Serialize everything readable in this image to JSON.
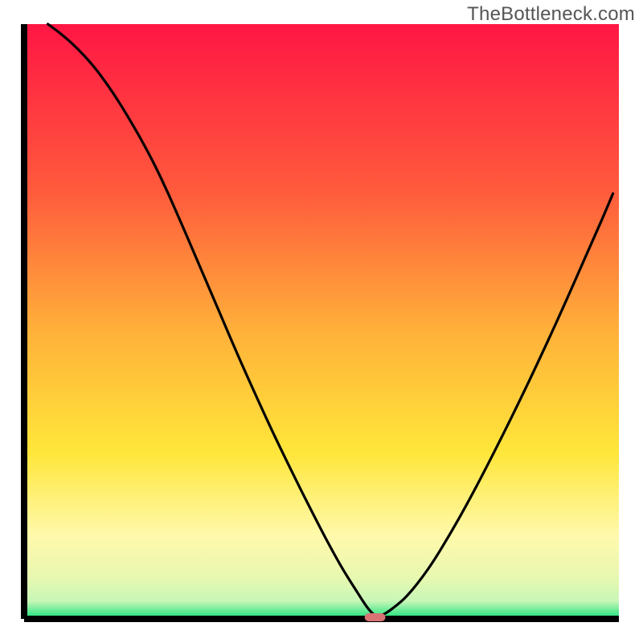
{
  "attribution": "TheBottleneck.com",
  "colors": {
    "gradient_top_red": "#ff1644",
    "gradient_mid_orange": "#ff8a3c",
    "gradient_yellow": "#ffe63a",
    "gradient_pale_yellow": "#fff9ab",
    "gradient_near_bottom": "#c8f7b7",
    "gradient_bottom_green": "#14e07a",
    "curve_stroke": "#000000",
    "axis_stroke": "#000000",
    "marker_fill": "#d97373"
  },
  "chart_data": {
    "type": "line",
    "title": "",
    "xlabel": "",
    "ylabel": "",
    "xlim": [
      0,
      100
    ],
    "ylim": [
      0,
      100
    ],
    "legend": false,
    "grid": false,
    "series": [
      {
        "name": "bottleneck-curve",
        "x": [
          4,
          6,
          8,
          10,
          12,
          14,
          16,
          18,
          20,
          22,
          24,
          27,
          30,
          33,
          36,
          39,
          42,
          45,
          48,
          51,
          53.5,
          56,
          57.5,
          58.5,
          59.3,
          60.5,
          62,
          64,
          66,
          68,
          70,
          73,
          76,
          79,
          82,
          85,
          88,
          91,
          94,
          97,
          99
        ],
        "y": [
          100,
          98.5,
          96.8,
          94.8,
          92.5,
          89.8,
          86.8,
          83.5,
          80,
          76.2,
          72,
          65.2,
          58.2,
          51.2,
          44.2,
          37.5,
          31,
          24.8,
          18.8,
          13,
          8.5,
          4.5,
          2.2,
          1,
          0.5,
          0.8,
          1.8,
          3.5,
          5.8,
          8.5,
          11.6,
          16.7,
          22.2,
          28,
          34,
          40.2,
          46.6,
          53.2,
          60,
          66.8,
          71.5
        ]
      }
    ],
    "marker": {
      "x": 59,
      "y": 0,
      "width": 3.5,
      "height": 1.2
    },
    "annotations": []
  }
}
